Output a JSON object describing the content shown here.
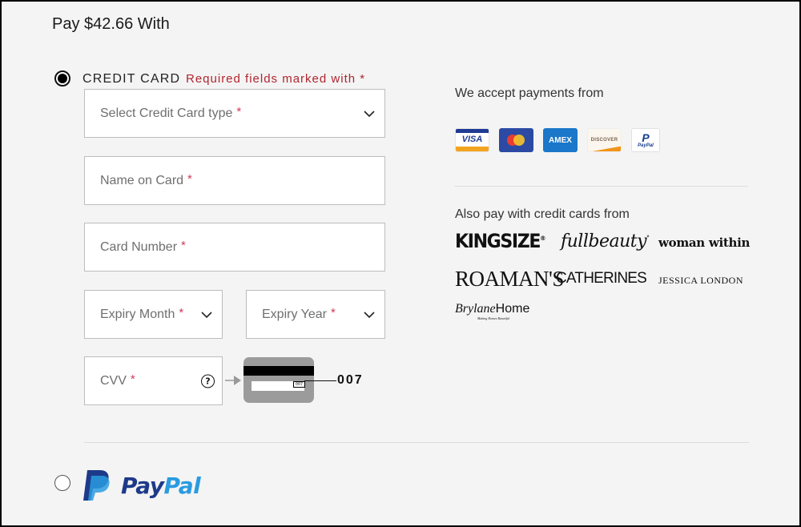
{
  "header": {
    "title": "Pay $42.66 With"
  },
  "credit_card": {
    "option_label": "CREDIT CARD",
    "selected": true,
    "required_note": "Required fields marked with *",
    "required_marker": "*",
    "fields": {
      "card_type": {
        "placeholder": "Select Credit Card type",
        "type": "select",
        "value": ""
      },
      "name_on_card": {
        "placeholder": "Name on Card",
        "type": "text",
        "value": ""
      },
      "card_number": {
        "placeholder": "Card Number",
        "type": "text",
        "value": ""
      },
      "expiry_month": {
        "placeholder": "Expiry Month",
        "type": "select",
        "value": ""
      },
      "expiry_year": {
        "placeholder": "Expiry Year",
        "type": "select",
        "value": ""
      },
      "cvv": {
        "placeholder": "CVV",
        "type": "text",
        "value": ""
      }
    },
    "cvv_help_icon": "?",
    "cvv_example": {
      "box_text": "007",
      "callout_text": "007"
    }
  },
  "accepted": {
    "title": "We accept payments from",
    "cards": [
      {
        "name": "VISA",
        "icon": "visa-logo"
      },
      {
        "name": "Mastercard",
        "icon": "mastercard-logo"
      },
      {
        "name": "AMEX",
        "icon": "amex-logo"
      },
      {
        "name": "DISCOVER",
        "icon": "discover-logo"
      },
      {
        "name": "PayPal",
        "icon": "paypal-logo",
        "glyph": "P",
        "small_text": "PayPal"
      }
    ]
  },
  "brands": {
    "title": "Also pay with credit cards from",
    "items": [
      {
        "name": "KINGSIZE",
        "mark": "®"
      },
      {
        "name": "fullbeauty",
        "mark": "°"
      },
      {
        "name": "woman within",
        "mark": "·"
      },
      {
        "name": "ROAMAN'S"
      },
      {
        "name": "CATHERINES",
        "mark": "·"
      },
      {
        "name": "JESSICA LONDON"
      },
      {
        "name_part1": "Brylane",
        "name_part2": "Home",
        "tagline": "Making Homes Beautiful"
      }
    ]
  },
  "paypal_option": {
    "selected": false,
    "word_part1": "Pay",
    "word_part2": "Pal",
    "colors": {
      "dark": "#1d3a89",
      "light": "#2a9be0"
    }
  },
  "colors": {
    "required_red": "#b0252e",
    "asterisk": "#d23a5b",
    "background": "#f4f4f4"
  }
}
